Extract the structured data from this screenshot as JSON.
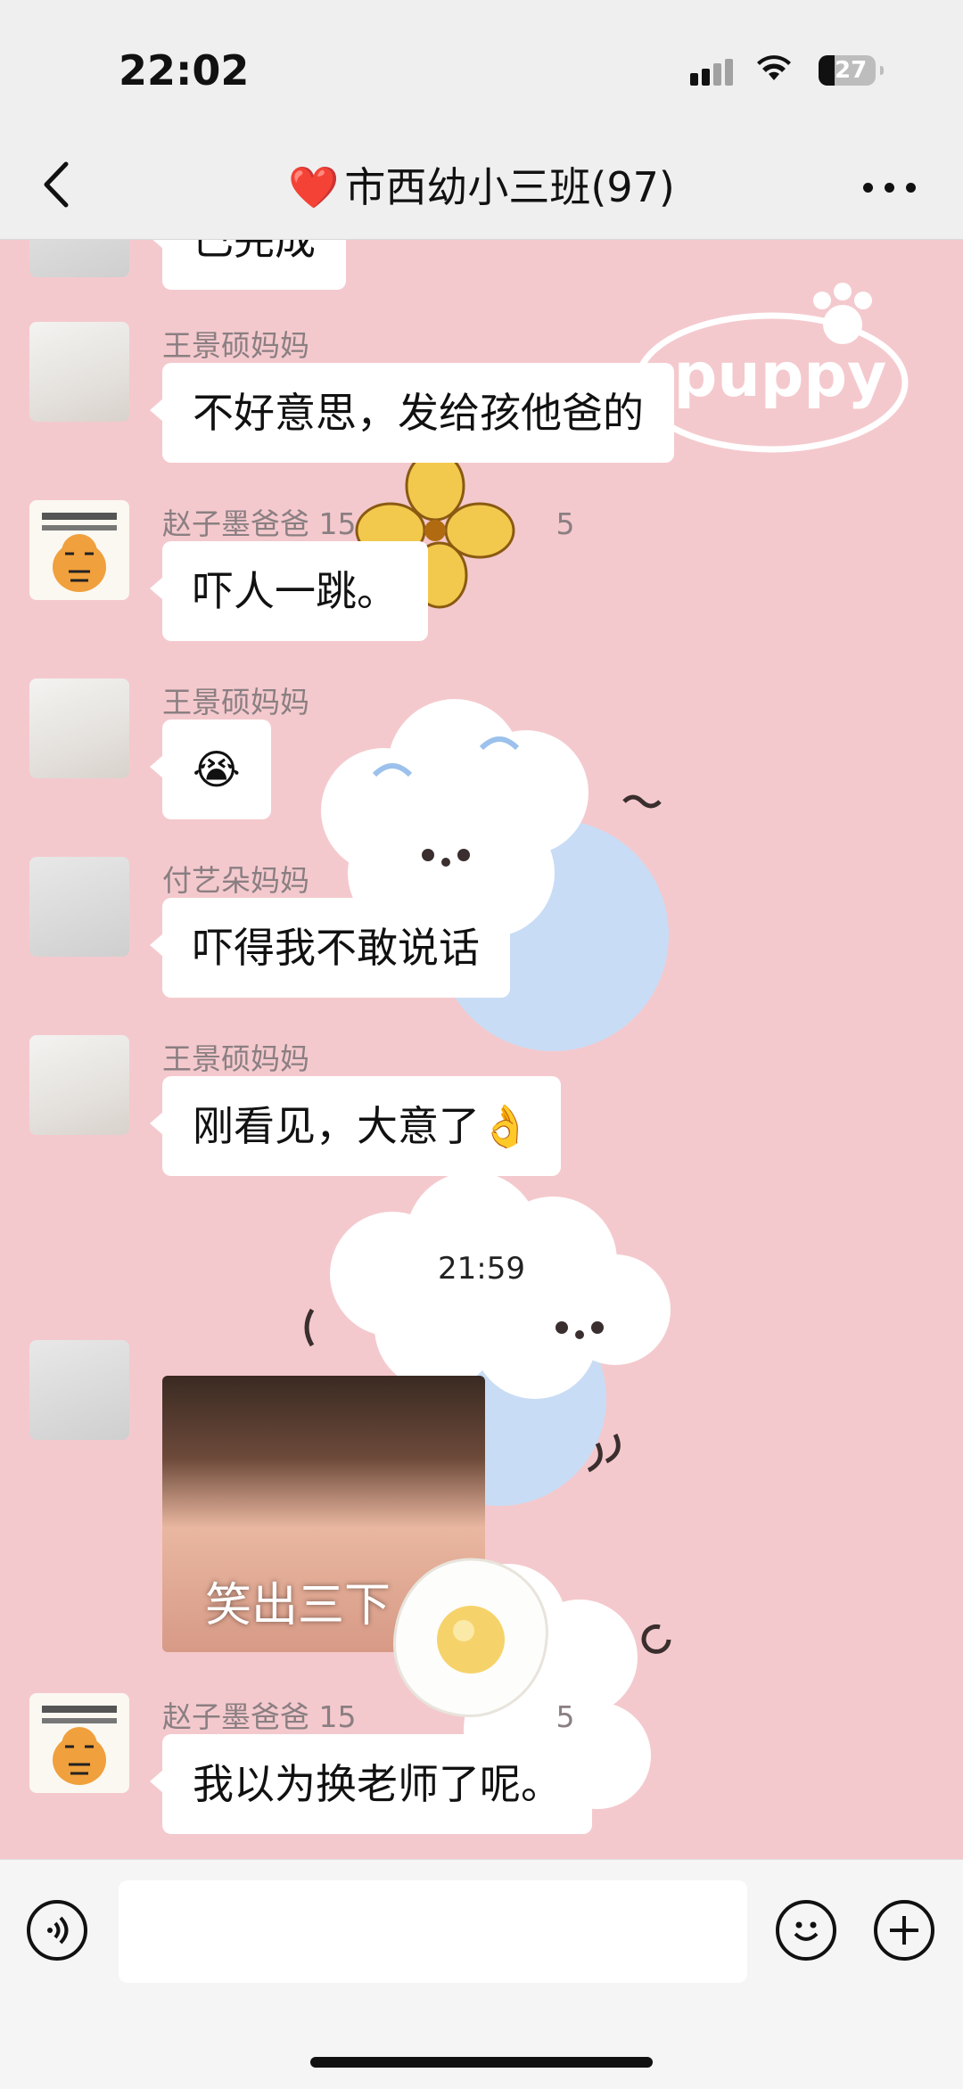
{
  "status_bar": {
    "time": "22:02",
    "battery": "27"
  },
  "header": {
    "title": "市西幼小三班(97)",
    "title_emoji": "❤️"
  },
  "messages": {
    "partial_bubble": "已完成",
    "m1": {
      "sender": "王景硕妈妈",
      "text": "不好意思，发给孩他爸的"
    },
    "m2": {
      "sender": "赵子墨爸爸 15",
      "sender_tail": "5",
      "text": "吓人一跳。"
    },
    "m3": {
      "sender": "王景硕妈妈",
      "text": "😭"
    },
    "m4": {
      "sender": "付艺朵妈妈",
      "text": "吓得我不敢说话"
    },
    "m5": {
      "sender": "王景硕妈妈",
      "text": "刚看见，大意了👌"
    },
    "timestamp": "21:59",
    "m6": {
      "image_caption": "笑出三下"
    },
    "m7": {
      "sender": "赵子墨爸爸 15",
      "sender_tail": "5",
      "text": "我以为换老师了呢。"
    }
  },
  "sticker": {
    "puppy_text": "puppy"
  },
  "input_bar": {
    "voice_icon": "voice-icon",
    "emoji_icon": "emoji-icon",
    "plus_icon": "plus-icon"
  }
}
